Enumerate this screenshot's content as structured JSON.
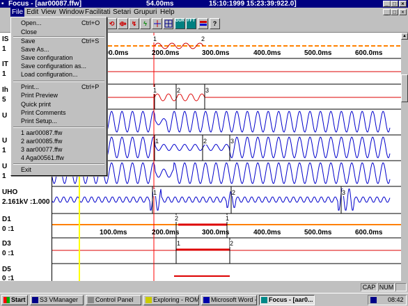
{
  "window": {
    "title": "Focus - [aar00087.ffw]",
    "time_span": "54.00ms",
    "timestamp": "15:10:1999 15:23:39:922.0]"
  },
  "menubar": {
    "items": [
      "File",
      "Edit",
      "View",
      "Window",
      "Facilitati",
      "Setari",
      "Grupuri",
      "Help"
    ]
  },
  "file_menu": {
    "open": "Open...",
    "open_shortcut": "Ctrl+O",
    "close": "Close",
    "save": "Save",
    "save_shortcut": "Ctrl+S",
    "save_as": "Save As...",
    "save_configuration": "Save configuration",
    "save_configuration_as": "Save configuration as...",
    "load_configuration": "Load configuration...",
    "print": "Print...",
    "print_shortcut": "Ctrl+P",
    "print_preview": "Print Preview",
    "quick_print": "Quick print",
    "print_comments": "Print Comments",
    "print_setup": "Print Setup...",
    "recent": [
      "1 aar00087.ffw",
      "2 aar00085.ffw",
      "3 aar00077.ffw",
      "4 Aga00561.ffw"
    ],
    "exit": "Exit"
  },
  "toolbar": {
    "btn_a": "⟲",
    "btn_b": "⟴",
    "btn_c": "↯",
    "btn_d": "ϟ",
    "dur": "DUR",
    "fft": "FFT",
    "help": "?"
  },
  "channels": [
    {
      "name": "IS",
      "value": "1"
    },
    {
      "name": "IT",
      "value": "1"
    },
    {
      "name": "Ih",
      "value": "5"
    },
    {
      "name": "U",
      "value": ""
    },
    {
      "name": "U",
      "value": "1"
    },
    {
      "name": "U",
      "value": "1"
    },
    {
      "name": "UHO",
      "value": "2.161kV :1.000"
    },
    {
      "name": "D1",
      "value": "0 :1"
    },
    {
      "name": "D3",
      "value": "0 :1"
    },
    {
      "name": "D5",
      "value": "0 :1"
    }
  ],
  "time_axis": {
    "top": [
      "100.0ms",
      "200.0ms",
      "300.0ms",
      "400.0ms",
      "500.0ms",
      "600.0ms"
    ],
    "bottom": [
      "100.0ms",
      "200.0ms",
      "300.0ms",
      "400.0ms",
      "500.0ms",
      "600.0ms"
    ]
  },
  "markers": {
    "m1": "1",
    "m2": "2",
    "m3": "3"
  },
  "status": {
    "cap": "CAP",
    "num": "NUM"
  },
  "taskbar": {
    "start": "Start",
    "tasks": [
      "S3 VManager",
      "Control Panel",
      "Exploring - ROM...",
      "Microsoft Word -...",
      "Focus - [aar0..."
    ],
    "clock": "08:42"
  },
  "colors": {
    "title_bar": "#000080",
    "waveform": "#0000cc",
    "cursor_yellow": "#ffff00",
    "cursor_red": "#ff0000",
    "trace_red": "#dd0000",
    "trace_orange": "#ff8000"
  }
}
